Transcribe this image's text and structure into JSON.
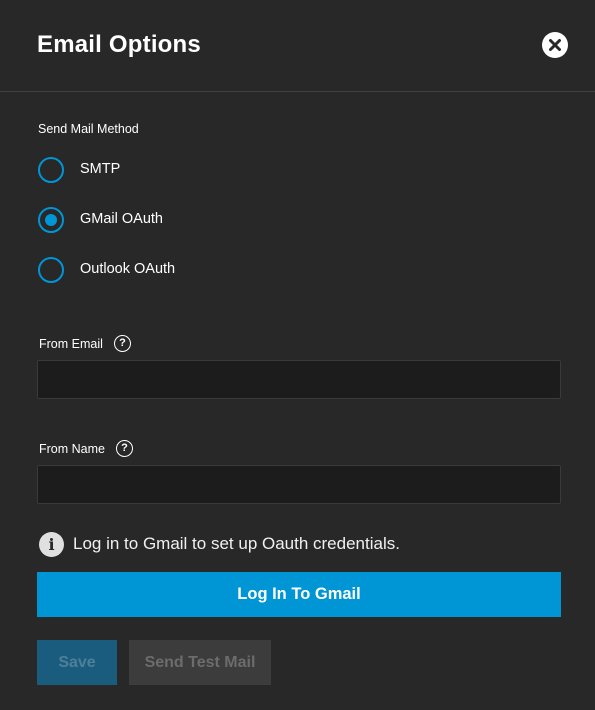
{
  "dialog": {
    "title": "Email Options",
    "close_icon": "close-icon"
  },
  "send_method": {
    "label": "Send Mail Method",
    "options": [
      {
        "label": "SMTP",
        "checked": false
      },
      {
        "label": "GMail OAuth",
        "checked": true
      },
      {
        "label": "Outlook OAuth",
        "checked": false
      }
    ]
  },
  "from_email": {
    "label": "From Email",
    "help_icon": "help-icon",
    "value": "",
    "placeholder": ""
  },
  "from_name": {
    "label": "From Name",
    "help_icon": "help-icon",
    "value": "",
    "placeholder": ""
  },
  "info": {
    "icon": "info-icon",
    "text": "Log in to Gmail to set up Oauth credentials."
  },
  "buttons": {
    "login": "Log In To Gmail",
    "save": "Save",
    "send_test": "Send Test Mail"
  },
  "colors": {
    "background": "#282828",
    "accent": "#0095d5",
    "input_bg": "#1c1c1c"
  }
}
